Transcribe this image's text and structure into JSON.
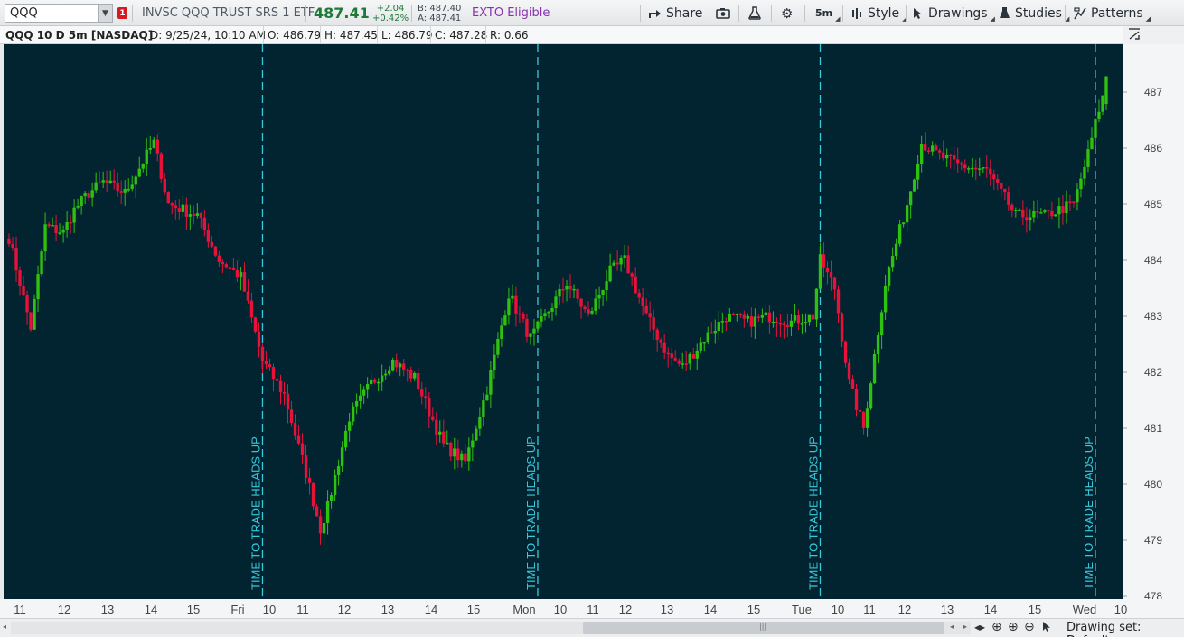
{
  "toolbar": {
    "symbol": "QQQ",
    "alert_count": "1",
    "description": "INVSC QQQ TRUST SRS 1 ETF",
    "last": "487.41",
    "change": "+2.04",
    "change_pct": "+0.42%",
    "bid": "B: 487.40",
    "ask": "A: 487.41",
    "exto": "EXTO Eligible",
    "share": "Share",
    "timeframe": "5m",
    "style": "Style",
    "drawings": "Drawings",
    "studies": "Studies",
    "patterns": "Patterns"
  },
  "info": {
    "title": "QQQ 10 D 5m [NASDAQ]",
    "date": "D: 9/25/24, 10:10 AM",
    "open": "O: 486.79",
    "high": "H: 487.45",
    "low": "L: 486.79",
    "close": "C: 487.28",
    "range": "R: 0.66"
  },
  "bottom": {
    "drawing_set": "Drawing set: Default"
  },
  "colors": {
    "background": "#022431",
    "up": "#2fc10f",
    "down": "#e8113a",
    "marker": "#38c9da",
    "axis_text": "#444444"
  },
  "chart_data": {
    "type": "candlestick",
    "symbol": "QQQ",
    "interval": "5m",
    "ylim": [
      478,
      487.6
    ],
    "yticks": [
      478,
      479,
      480,
      481,
      482,
      483,
      484,
      485,
      486,
      487
    ],
    "xticks": [
      "11",
      "12",
      "13",
      "14",
      "15",
      "Fri",
      "10",
      "11",
      "12",
      "13",
      "14",
      "15",
      "Mon",
      "10",
      "11",
      "12",
      "13",
      "14",
      "15",
      "Tue",
      "10",
      "11",
      "12",
      "13",
      "14",
      "15",
      "Wed",
      "10"
    ],
    "session_markers": [
      "TIME TO TRADE HEADS UP",
      "TIME TO TRADE HEADS UP",
      "TIME TO TRADE HEADS UP",
      "TIME TO TRADE HEADS UP"
    ],
    "anchors": [
      {
        "bar": 0,
        "price": 484.4
      },
      {
        "bar": 6,
        "price": 482.8
      },
      {
        "bar": 10,
        "price": 484.6
      },
      {
        "bar": 15,
        "price": 484.5
      },
      {
        "bar": 18,
        "price": 484.9
      },
      {
        "bar": 22,
        "price": 485.2
      },
      {
        "bar": 26,
        "price": 485.4
      },
      {
        "bar": 32,
        "price": 485.2
      },
      {
        "bar": 40,
        "price": 486.1
      },
      {
        "bar": 44,
        "price": 485.0
      },
      {
        "bar": 52,
        "price": 484.8
      },
      {
        "bar": 58,
        "price": 484.0
      },
      {
        "bar": 64,
        "price": 483.7
      },
      {
        "bar": 70,
        "price": 482.2
      },
      {
        "bar": 76,
        "price": 481.6
      },
      {
        "bar": 82,
        "price": 480.2
      },
      {
        "bar": 86,
        "price": 479.2
      },
      {
        "bar": 88,
        "price": 479.6
      },
      {
        "bar": 94,
        "price": 481.2
      },
      {
        "bar": 100,
        "price": 481.8
      },
      {
        "bar": 106,
        "price": 482.2
      },
      {
        "bar": 112,
        "price": 481.9
      },
      {
        "bar": 120,
        "price": 480.7
      },
      {
        "bar": 126,
        "price": 480.4
      },
      {
        "bar": 132,
        "price": 481.7
      },
      {
        "bar": 138,
        "price": 483.4
      },
      {
        "bar": 144,
        "price": 482.6
      },
      {
        "bar": 148,
        "price": 483.0
      },
      {
        "bar": 154,
        "price": 483.6
      },
      {
        "bar": 160,
        "price": 483.0
      },
      {
        "bar": 166,
        "price": 483.8
      },
      {
        "bar": 170,
        "price": 484.0
      },
      {
        "bar": 176,
        "price": 483.0
      },
      {
        "bar": 182,
        "price": 482.3
      },
      {
        "bar": 186,
        "price": 482.1
      },
      {
        "bar": 192,
        "price": 482.6
      },
      {
        "bar": 198,
        "price": 483.0
      },
      {
        "bar": 204,
        "price": 482.9
      },
      {
        "bar": 210,
        "price": 483.0
      },
      {
        "bar": 216,
        "price": 482.9
      },
      {
        "bar": 222,
        "price": 483.0
      },
      {
        "bar": 224,
        "price": 484.0
      },
      {
        "bar": 228,
        "price": 483.5
      },
      {
        "bar": 232,
        "price": 481.8
      },
      {
        "bar": 236,
        "price": 481.0
      },
      {
        "bar": 242,
        "price": 483.6
      },
      {
        "bar": 248,
        "price": 485.0
      },
      {
        "bar": 252,
        "price": 486.1
      },
      {
        "bar": 256,
        "price": 485.9
      },
      {
        "bar": 262,
        "price": 485.7
      },
      {
        "bar": 270,
        "price": 485.6
      },
      {
        "bar": 278,
        "price": 484.8
      },
      {
        "bar": 286,
        "price": 484.8
      },
      {
        "bar": 294,
        "price": 485.0
      },
      {
        "bar": 298,
        "price": 485.9
      },
      {
        "bar": 301,
        "price": 486.7
      },
      {
        "bar": 303,
        "price": 487.1
      }
    ],
    "total_bars": 304,
    "marker_bars": [
      70,
      146,
      224,
      300
    ],
    "last_bar": {
      "open": 486.79,
      "high": 487.45,
      "low": 486.79,
      "close": 487.28
    }
  }
}
